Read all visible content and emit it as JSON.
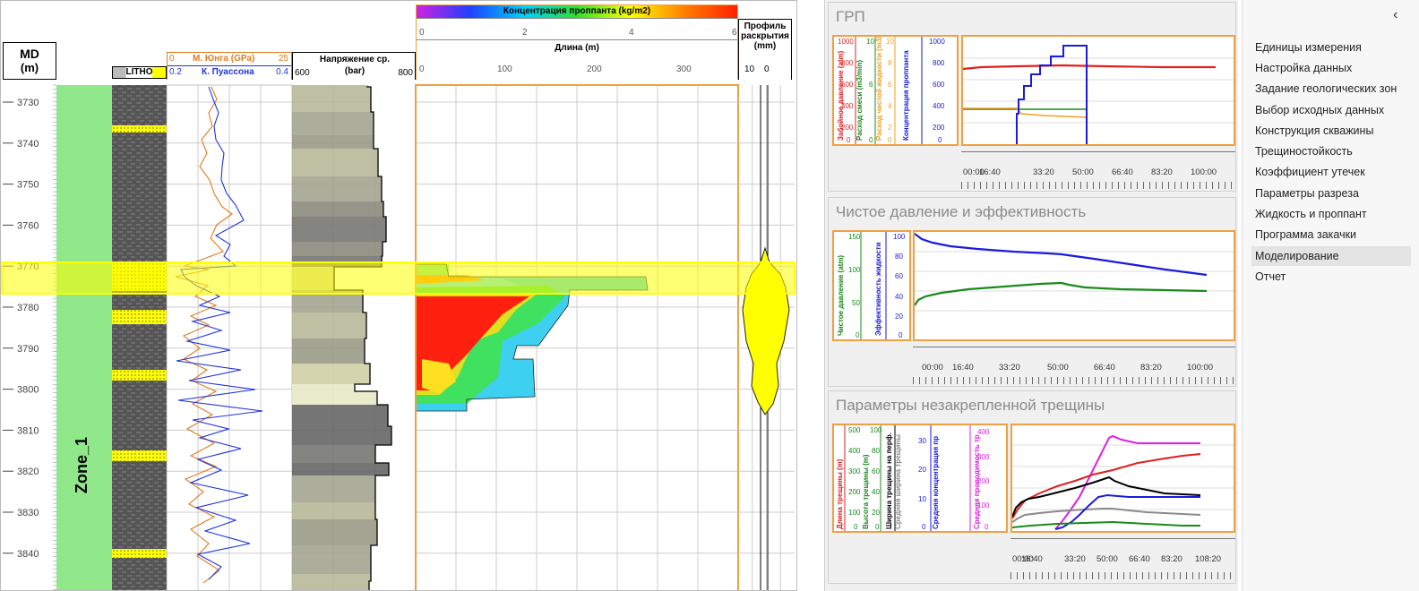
{
  "log": {
    "md_header": "MD",
    "md_unit": "(m)",
    "litho": "LITHO",
    "young": {
      "label": "М. Юнга (GPa)",
      "min": "0",
      "max": "25",
      "color": "#e07a1f"
    },
    "poisson": {
      "label": "К. Пуассона",
      "min": "0.2",
      "max": "0.4",
      "color": "#1f33e0"
    },
    "stress": {
      "label": "Напряжение ср.",
      "unit": "(bar)",
      "min": "600",
      "max": "800"
    },
    "conc": {
      "label": "Концентрация проппанта (kg/m2)",
      "ticks": [
        "0",
        "2",
        "4",
        "6"
      ]
    },
    "length": {
      "label": "Длина (m)",
      "ticks": [
        "0",
        "100",
        "200",
        "300"
      ]
    },
    "profile": {
      "label1": "Профиль",
      "label2": "раскрытия",
      "label3": "(mm)",
      "min": "10",
      "max": "0",
      "color": "#ffff00"
    },
    "zone": "Zone_1",
    "depths": [
      "3730",
      "3740",
      "3750",
      "3760",
      "3770",
      "3780",
      "3790",
      "3800",
      "3810",
      "3820",
      "3830",
      "3840"
    ],
    "highlight_color": "#ffff00"
  },
  "charts": [
    {
      "title": "ГРП",
      "axes": [
        {
          "label": "Забойное давление (atm)",
          "color": "#e02020",
          "ticks": [
            "1000",
            "800",
            "600",
            "400",
            "200",
            "0"
          ]
        },
        {
          "label": "Расход смеси (m3/min)",
          "color": "#1a8a1a",
          "ticks": [
            "10",
            "8",
            "6",
            "4",
            "2",
            "0"
          ]
        },
        {
          "label": "Расход чистой жидкости (m3/min)",
          "color": "#f0a020",
          "ticks": [
            "10",
            "8",
            "6",
            "4",
            "2",
            "0"
          ]
        },
        {
          "label": "Концентрация проппанта",
          "color": "#1a1ae0",
          "ticks": [
            "1000",
            "800",
            "600",
            "400",
            "200",
            "0"
          ]
        }
      ],
      "x_ticks": [
        "00:00",
        "16:40",
        "33:20",
        "50:00",
        "66:40",
        "83:20",
        "100:00"
      ]
    },
    {
      "title": "Чистое давление и эффективность",
      "axes": [
        {
          "label": "Чистое давление (atm)",
          "color": "#1a8a1a",
          "ticks": [
            "150",
            "100",
            "50",
            "0"
          ]
        },
        {
          "label": "Эффективность жидкости",
          "color": "#1a1ae0",
          "ticks": [
            "100",
            "80",
            "60",
            "40",
            "20",
            "0"
          ]
        }
      ],
      "x_ticks": [
        "00:00",
        "16:40",
        "33:20",
        "50:00",
        "66:40",
        "83:20",
        "100:00"
      ]
    },
    {
      "title": "Параметры незакрепленной трещины",
      "axes": [
        {
          "label": "Длина трещины (m)",
          "color": "#e02020",
          "ticks": [
            "500",
            "400",
            "300",
            "200",
            "100",
            "0"
          ]
        },
        {
          "label": "Высота трещины (m)",
          "color": "#1a8a1a",
          "ticks": [
            "100",
            "80",
            "60",
            "40",
            "20",
            "0"
          ]
        },
        {
          "label": "Ширина трещины на перф.",
          "color": "#000000",
          "ticks": []
        },
        {
          "label": "Средняя ширина трещины",
          "color": "#8a8a8a",
          "ticks": []
        },
        {
          "label": "Средняя концентрация пр",
          "color": "#1a1ae0",
          "ticks": [
            "30",
            "20",
            "10",
            "0"
          ]
        },
        {
          "label": "Средняя проводимость тр",
          "color": "#e020e0",
          "ticks": [
            "400",
            "300",
            "200",
            "100",
            "0"
          ]
        }
      ],
      "x_ticks": [
        "00:00",
        "16:40",
        "33:20",
        "50:00",
        "66:40",
        "83:20",
        "108:20"
      ]
    }
  ],
  "nav": {
    "collapse": "‹",
    "items": [
      "Единицы измерения",
      "Настройка данных",
      "Задание геологических зон",
      "Выбор исходных данных",
      "Конструкция скважины",
      "Трещиностойкость",
      "Коэффициент утечек",
      "Параметры разреза",
      "Жидкость и проппант",
      "Программа закачки",
      "Моделирование",
      "Отчет"
    ],
    "selected_index": 10
  }
}
